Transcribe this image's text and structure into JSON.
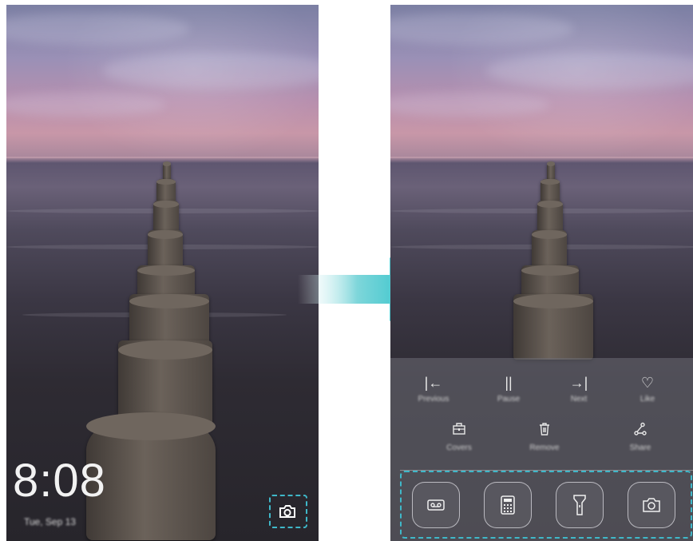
{
  "left_screen": {
    "clock": "8:08",
    "date": "Tue, Sep 13",
    "camera_icon": "camera-icon"
  },
  "right_screen": {
    "media_controls": [
      {
        "icon": "previous-icon",
        "glyph": "|←",
        "label": "Previous"
      },
      {
        "icon": "pause-icon",
        "glyph": "||",
        "label": "Pause"
      },
      {
        "icon": "next-icon",
        "glyph": "→|",
        "label": "Next"
      },
      {
        "icon": "heart-icon",
        "glyph": "♡",
        "label": "Like"
      }
    ],
    "magazine_controls": [
      {
        "icon": "covers-icon",
        "label": "Covers"
      },
      {
        "icon": "trash-icon",
        "label": "Remove"
      },
      {
        "icon": "share-icon",
        "label": "Share"
      }
    ],
    "shortcuts": [
      {
        "icon": "recorder-icon"
      },
      {
        "icon": "calculator-icon"
      },
      {
        "icon": "flashlight-icon"
      },
      {
        "icon": "camera-icon"
      }
    ]
  },
  "colors": {
    "highlight_dashed": "#3fb8c9",
    "arrow": "#2cc0c7"
  }
}
